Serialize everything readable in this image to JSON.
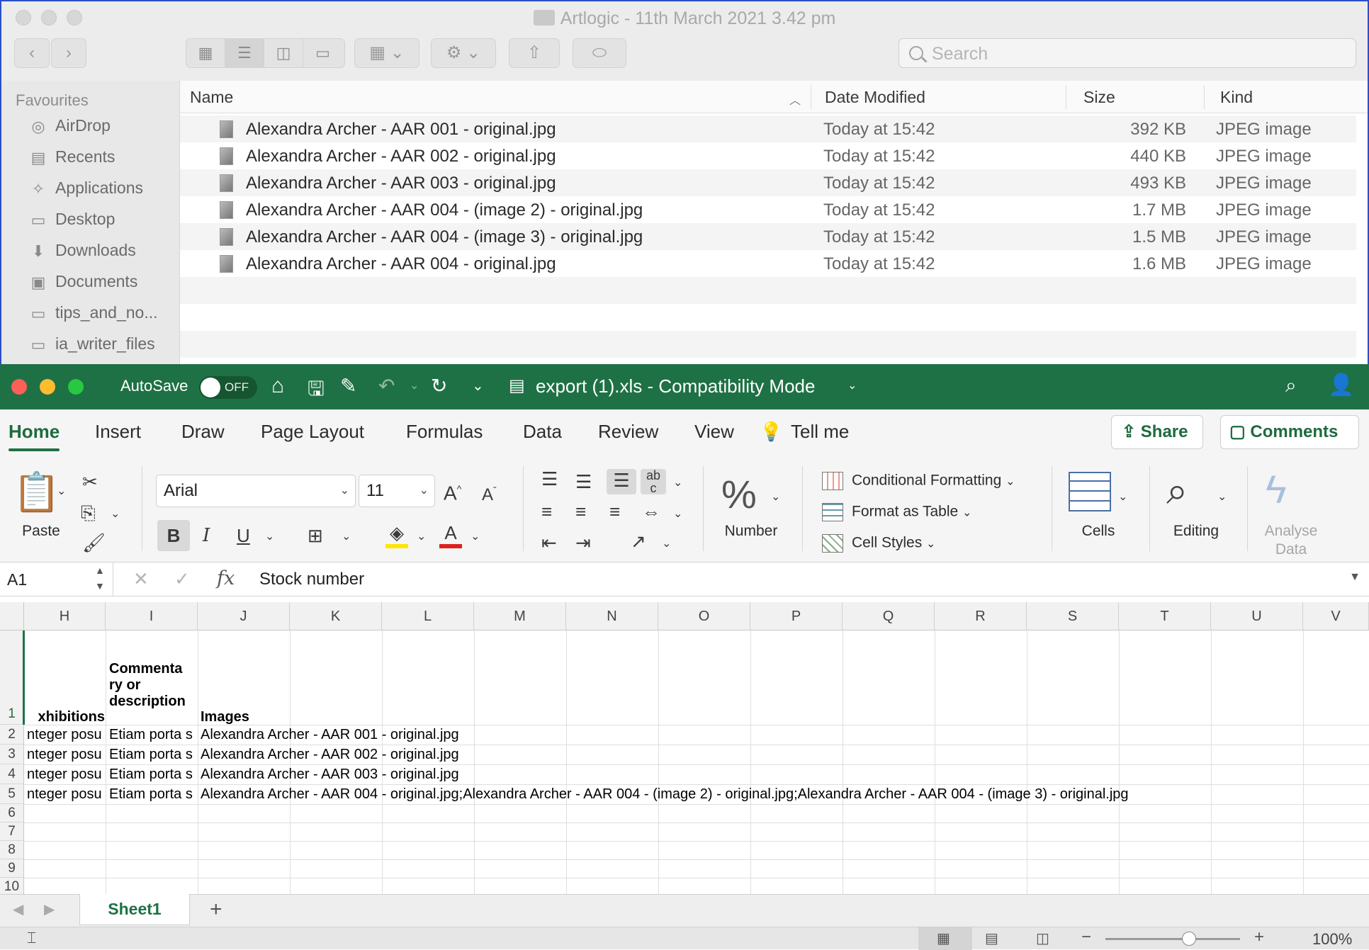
{
  "finder": {
    "title": "Artlogic - 11th March 2021 3.42 pm",
    "search_placeholder": "Search",
    "sidebar_heading": "Favourites",
    "sidebar_items": [
      {
        "label": "AirDrop",
        "icon": "airdrop-icon"
      },
      {
        "label": "Recents",
        "icon": "recents-icon"
      },
      {
        "label": "Applications",
        "icon": "applications-icon"
      },
      {
        "label": "Desktop",
        "icon": "desktop-icon"
      },
      {
        "label": "Downloads",
        "icon": "downloads-icon"
      },
      {
        "label": "Documents",
        "icon": "documents-icon"
      },
      {
        "label": "tips_and_no...",
        "icon": "folder-icon"
      },
      {
        "label": "ia_writer_files",
        "icon": "folder-icon"
      }
    ],
    "columns": {
      "name": "Name",
      "date": "Date Modified",
      "size": "Size",
      "kind": "Kind"
    },
    "files": [
      {
        "name": "Alexandra Archer - AAR 001 - original.jpg",
        "date": "Today at 15:42",
        "size": "392 KB",
        "kind": "JPEG image"
      },
      {
        "name": "Alexandra Archer - AAR 002 - original.jpg",
        "date": "Today at 15:42",
        "size": "440 KB",
        "kind": "JPEG image"
      },
      {
        "name": "Alexandra Archer - AAR 003 - original.jpg",
        "date": "Today at 15:42",
        "size": "493 KB",
        "kind": "JPEG image"
      },
      {
        "name": "Alexandra Archer - AAR 004 - (image 2) - original.jpg",
        "date": "Today at 15:42",
        "size": "1.7 MB",
        "kind": "JPEG image"
      },
      {
        "name": "Alexandra Archer - AAR 004 - (image 3) - original.jpg",
        "date": "Today at 15:42",
        "size": "1.5 MB",
        "kind": "JPEG image"
      },
      {
        "name": "Alexandra Archer - AAR 004 - original.jpg",
        "date": "Today at 15:42",
        "size": "1.6 MB",
        "kind": "JPEG image"
      }
    ]
  },
  "excel": {
    "autosave_label": "AutoSave",
    "autosave_state": "OFF",
    "doc_title": "export (1).xls  -  Compatibility Mode",
    "tabs": [
      "Home",
      "Insert",
      "Draw",
      "Page Layout",
      "Formulas",
      "Data",
      "Review",
      "View",
      "Tell me"
    ],
    "share_label": "Share",
    "comments_label": "Comments",
    "paste_label": "Paste",
    "font_name": "Arial",
    "font_size": "11",
    "number_label": "Number",
    "cond_format_label": "Conditional Formatting",
    "format_table_label": "Format as Table",
    "cell_styles_label": "Cell Styles",
    "cells_label": "Cells",
    "editing_label": "Editing",
    "analyse_label_1": "Analyse",
    "analyse_label_2": "Data",
    "name_box": "A1",
    "formula": "Stock number",
    "columns": [
      "H",
      "I",
      "J",
      "K",
      "L",
      "M",
      "N",
      "O",
      "P",
      "Q",
      "R",
      "S",
      "T",
      "U",
      "V"
    ],
    "rows": [
      "1",
      "2",
      "3",
      "4",
      "5",
      "6",
      "7",
      "8",
      "9",
      "10"
    ],
    "header_cells": {
      "h1": "xhibitions",
      "i1a": "Commenta",
      "i1b": "ry or",
      "i1c": "description",
      "j1": "Images"
    },
    "data_rows": [
      {
        "h": "nteger posu",
        "i": "Etiam porta s",
        "j": "Alexandra Archer - AAR 001 - original.jpg"
      },
      {
        "h": "nteger posu",
        "i": "Etiam porta s",
        "j": "Alexandra Archer - AAR 002 - original.jpg"
      },
      {
        "h": "nteger posu",
        "i": "Etiam porta s",
        "j": "Alexandra Archer - AAR 003 - original.jpg"
      },
      {
        "h": "nteger posu",
        "i": "Etiam porta s",
        "j": "Alexandra Archer - AAR 004 - original.jpg;Alexandra Archer - AAR 004 - (image 2) - original.jpg;Alexandra Archer - AAR 004 - (image 3) - original.jpg"
      }
    ],
    "sheet_tab": "Sheet1",
    "zoom": "100%",
    "zoom_fraction": 0.62
  },
  "colors": {
    "excel_green": "#1e7145",
    "finder_border": "#2b4fc9"
  }
}
